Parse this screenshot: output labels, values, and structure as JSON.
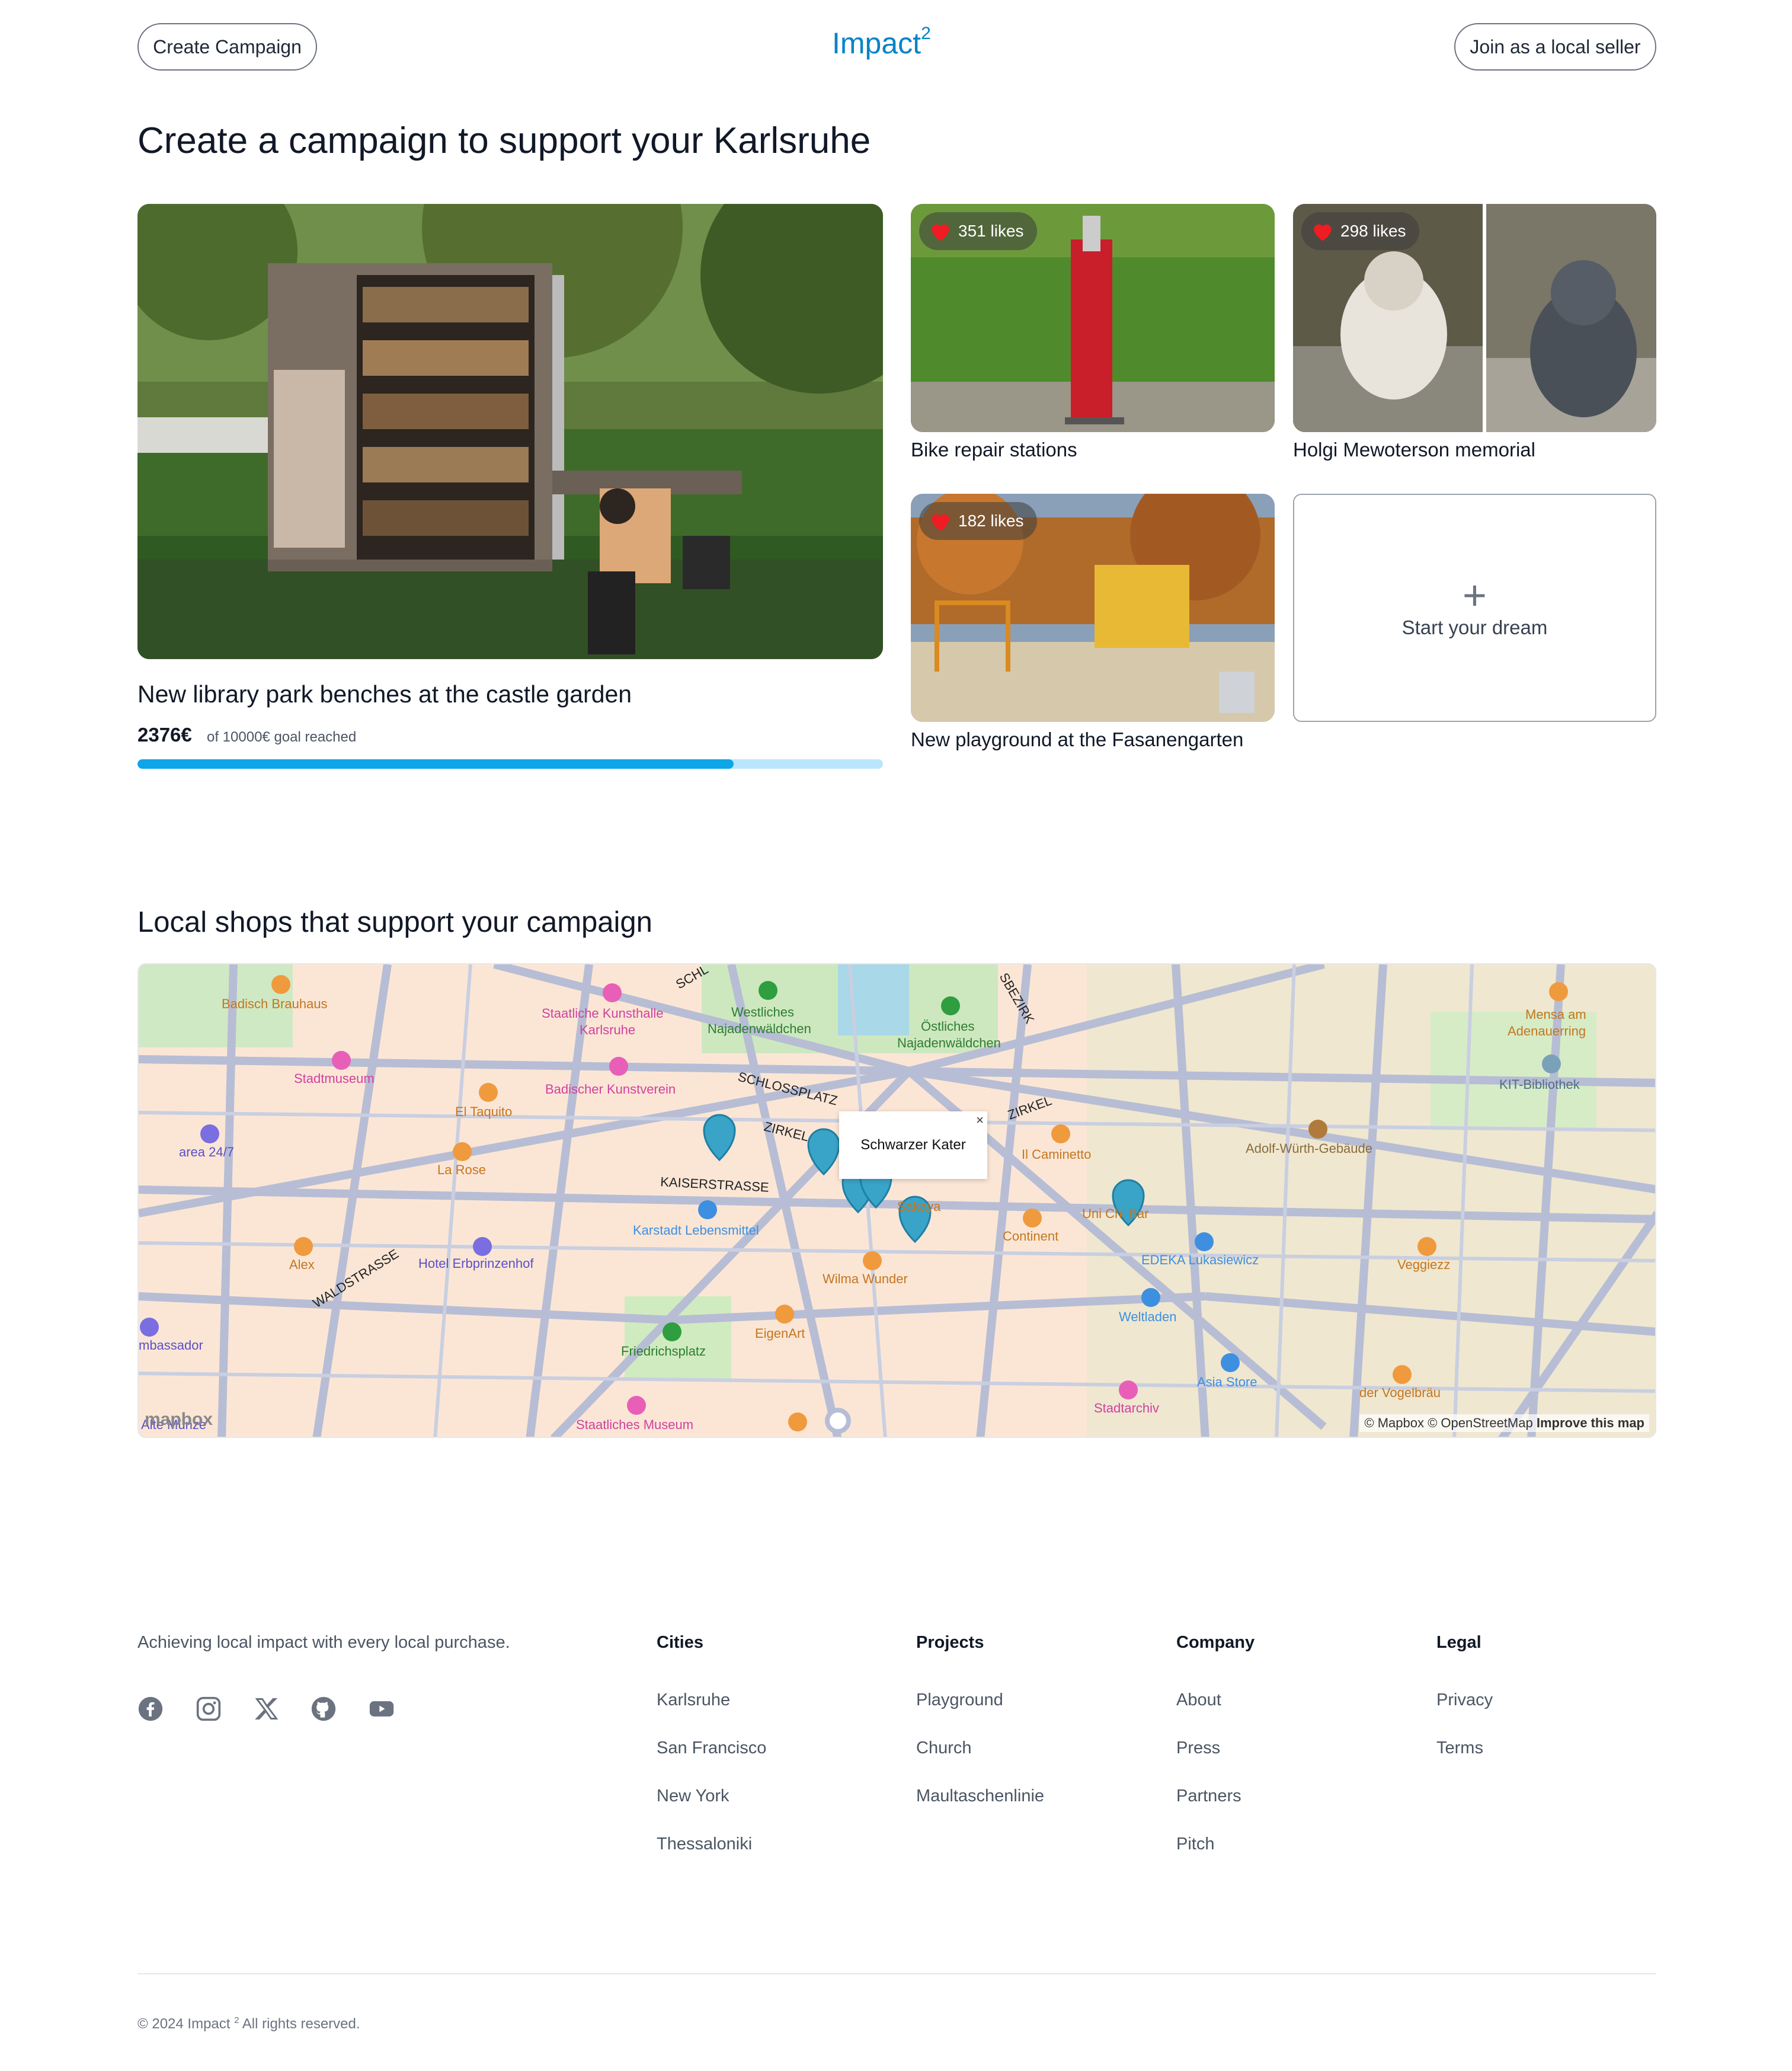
{
  "header": {
    "create_label": "Create Campaign",
    "logo_text": "Impact",
    "logo_sup": "2",
    "join_label": "Join as a local seller"
  },
  "page": {
    "title": "Create a campaign to support your Karlsruhe"
  },
  "featured": {
    "title": "New library park benches at the castle garden",
    "raised": "2376€",
    "goal_text": "of 10000€ goal reached",
    "progress_fraction": 0.8
  },
  "cards": [
    {
      "likes": "351 likes",
      "caption": "Bike repair stations"
    },
    {
      "likes": "298 likes",
      "caption": "Holgi Mewoterson memorial"
    },
    {
      "likes": "182 likes",
      "caption": "New playground at the Fasanengarten"
    }
  ],
  "dream": {
    "label": "Start your dream"
  },
  "shops": {
    "title": "Local shops that support your campaign",
    "popup": "Schwarzer Kater",
    "popup_close": "×",
    "attribution": "© Mapbox © OpenStreetMap",
    "improve": "Improve this map",
    "mapbox_logo": "mapbox",
    "labels": {
      "badisch": "Badisch Brauhaus",
      "kunsthalle1": "Staatliche Kunsthalle",
      "kunsthalle2": "Karlsruhe",
      "westliches1": "Westliches",
      "westliches2": "Najadenwäldchen",
      "oestliches1": "Östliches",
      "oestliches2": "Najadenwäldchen",
      "mensa1": "Mensa am",
      "mensa2": "Adenauerring",
      "kit": "KIT-Bibliothek",
      "stadtmuseum": "Stadtmuseum",
      "kunstverein": "Badischer Kunstverein",
      "eltaquito": "El Taquito",
      "area": "area 24/7",
      "larose": "La Rose",
      "schlossplatz": "SCHLOSSPLATZ",
      "zirkel1": "ZIRKEL",
      "zirkel2": "ZIRKEL",
      "kaiser": "KAISERSTRASSE",
      "karstadt": "Karstadt Lebensmittel",
      "ilcaminetto": "Il Caminetto",
      "adolf": "Adolf-Würth-Gebäude",
      "unichibar": "Uni Chi Bar",
      "continent": "Continent",
      "sakaya": "Sakaya",
      "alex": "Alex",
      "waldstrasse": "WALDSTRASSE",
      "hotel": "Hotel Erbprinzenhof",
      "wilma": "Wilma Wunder",
      "edeka": "EDEKA Lukasiewicz",
      "veggiezz": "Veggiezz",
      "weltladen": "Weltladen",
      "ambassador": "mbassador",
      "friedrichsplatz": "Friedrichsplatz",
      "eigenart": "EigenArt",
      "asia": "Asia Store",
      "vogelbrau": "der Vogelbräu",
      "stadtarchiv": "Stadtarchiv",
      "altemunze": "Alte Münze",
      "staatmuseum": "Staatliches Museum",
      "bezirk": "SBEZIRK",
      "schl": "SCHL"
    }
  },
  "footer": {
    "tagline": "Achieving local impact with every local purchase.",
    "social": [
      "facebook-icon",
      "instagram-icon",
      "x-icon",
      "github-icon",
      "youtube-icon"
    ],
    "columns": [
      {
        "heading": "Cities",
        "links": [
          "Karlsruhe",
          "San Francisco",
          "New York",
          "Thessaloniki"
        ]
      },
      {
        "heading": "Projects",
        "links": [
          "Playground",
          "Church",
          "Maultaschenlinie"
        ]
      },
      {
        "heading": "Company",
        "links": [
          "About",
          "Press",
          "Partners",
          "Pitch"
        ]
      },
      {
        "heading": "Legal",
        "links": [
          "Privacy",
          "Terms"
        ]
      }
    ],
    "copyright_pre": "© 2024 Impact",
    "copyright_sup": "2",
    "copyright_post": "All rights reserved."
  },
  "colors": {
    "brand": "#0284c7",
    "progress": "#0ea5e9",
    "progress_track": "#bae6fd",
    "like_heart": "#ef1c24",
    "map_marker": "#3aa3c8"
  }
}
